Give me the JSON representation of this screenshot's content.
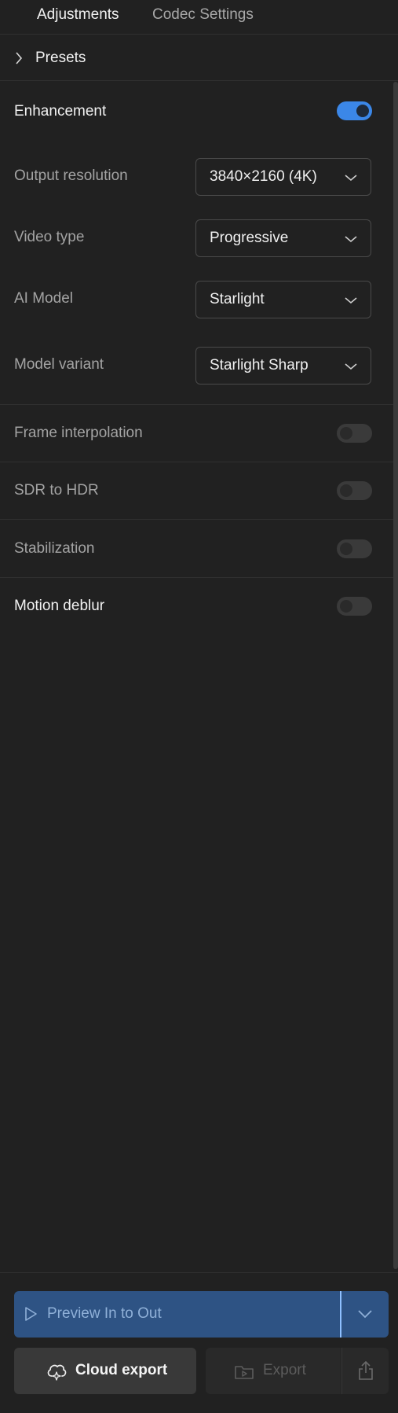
{
  "tabs": {
    "adjustments": "Adjustments",
    "codec_settings": "Codec Settings"
  },
  "presets": {
    "label": "Presets"
  },
  "enhancement": {
    "title": "Enhancement",
    "enabled": true,
    "output_resolution": {
      "label": "Output resolution",
      "value": "3840×2160 (4K)"
    },
    "video_type": {
      "label": "Video type",
      "value": "Progressive"
    },
    "ai_model": {
      "label": "AI Model",
      "value": "Starlight"
    },
    "model_variant": {
      "label": "Model variant",
      "value": "Starlight Sharp"
    }
  },
  "features": {
    "frame_interpolation": {
      "label": "Frame interpolation",
      "enabled": false
    },
    "sdr_to_hdr": {
      "label": "SDR to HDR",
      "enabled": false
    },
    "stabilization": {
      "label": "Stabilization",
      "enabled": false
    },
    "motion_deblur": {
      "label": "Motion deblur",
      "enabled": false
    }
  },
  "footer": {
    "preview_label": "Preview In to Out",
    "cloud_export_label": "Cloud export",
    "export_label": "Export"
  },
  "colors": {
    "background": "#212121",
    "accent": "#3b87e8",
    "preview_button": "#2e5384"
  },
  "icons": {
    "presets": "chevron-right-icon",
    "dropdown": "chevron-down-icon",
    "preview": "play-icon",
    "cloud_export": "cloud-sparkle-icon",
    "export": "folder-play-icon",
    "share": "share-icon"
  }
}
